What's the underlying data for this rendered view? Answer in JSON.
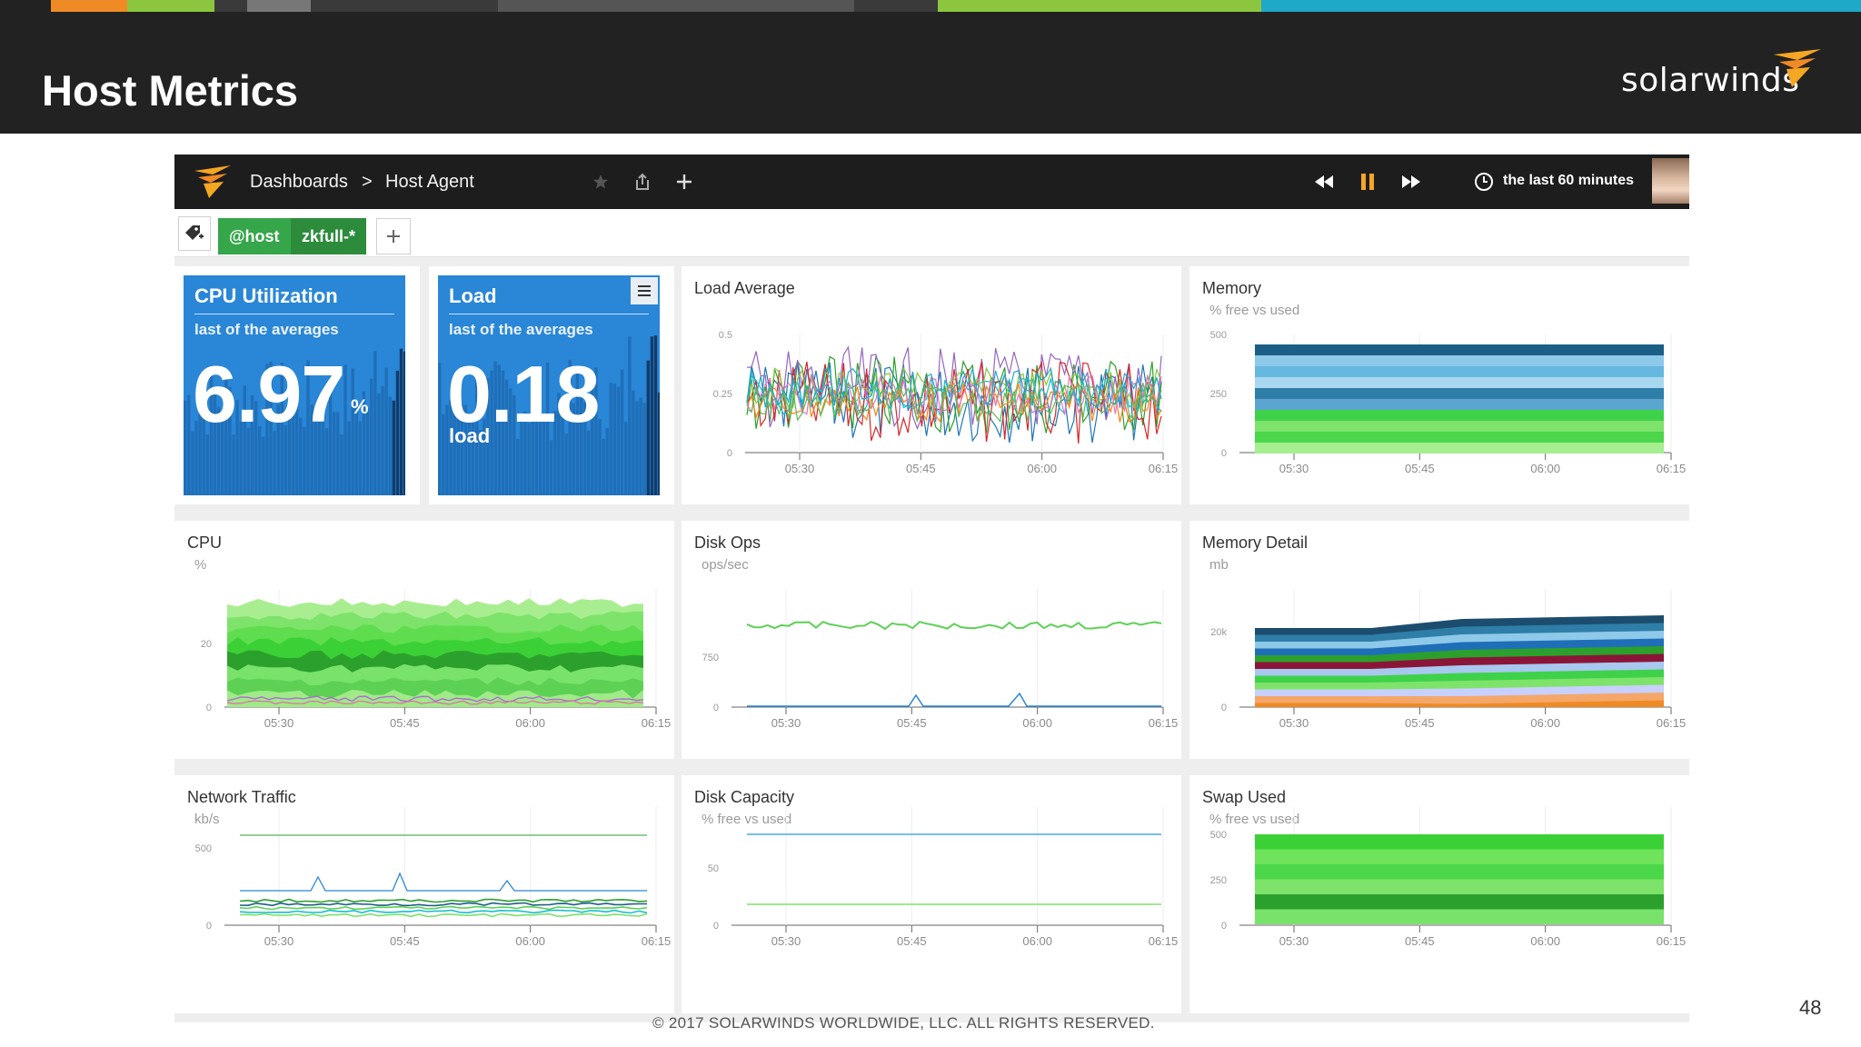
{
  "slide": {
    "title": "Host Metrics",
    "brand": "solarwinds",
    "footer": "© 2017 SOLARWINDS WORLDWIDE, LLC. ALL RIGHTS RESERVED.",
    "page_number": "48",
    "strip_colors": [
      "#222222",
      "#f08a24",
      "#8cc63f",
      "#3a3a3a",
      "#777777",
      "#3a3a3a",
      "#555555",
      "#3a3a3a",
      "#8cc63f",
      "#1fa9c9"
    ]
  },
  "nav": {
    "breadcrumb_root": "Dashboards",
    "breadcrumb_sep": ">",
    "breadcrumb_current": "Host Agent",
    "time_range": "the last 60 minutes",
    "icons": [
      "solarwinds-logo-icon",
      "star-icon",
      "share-icon",
      "plus-icon",
      "rewind-icon",
      "pause-icon",
      "fast-forward-icon",
      "clock-icon"
    ]
  },
  "toolbar": {
    "tag_key": "@host",
    "tag_value": "zkfull-*",
    "add_label": "+"
  },
  "colors": {
    "stat_blue": "#2a86d6",
    "green_dark": "#2ca02c",
    "green_light": "#79e26a",
    "accent_orange": "#f5a623"
  },
  "panels": {
    "cpu_util": {
      "title": "CPU Utilization",
      "subtitle": "last of the averages",
      "value": "6.97",
      "unit": "%"
    },
    "load": {
      "title": "Load",
      "subtitle": "last of the averages",
      "value": "0.18",
      "unit": "load"
    },
    "load_avg": {
      "title": "Load Average",
      "y_ticks": [
        "0.5",
        "0.25",
        "0"
      ],
      "x_ticks": [
        "05:30",
        "05:45",
        "06:00",
        "06:15"
      ]
    },
    "memory": {
      "title": "Memory",
      "subtitle": "% free vs used",
      "y_ticks": [
        "500",
        "250",
        "0"
      ],
      "x_ticks": [
        "05:30",
        "05:45",
        "06:00",
        "06:15"
      ]
    },
    "cpu": {
      "title": "CPU",
      "subtitle": "%",
      "y_ticks": [
        "20",
        "0"
      ],
      "x_ticks": [
        "05:30",
        "05:45",
        "06:00",
        "06:15"
      ]
    },
    "disk_ops": {
      "title": "Disk Ops",
      "subtitle": "ops/sec",
      "y_ticks": [
        "750",
        "0"
      ],
      "x_ticks": [
        "05:30",
        "05:45",
        "06:00",
        "06:15"
      ]
    },
    "memory_detail": {
      "title": "Memory Detail",
      "subtitle": "mb",
      "y_ticks": [
        "20k",
        "0"
      ],
      "x_ticks": [
        "05:30",
        "05:45",
        "06:00",
        "06:15"
      ]
    },
    "network": {
      "title": "Network Traffic",
      "subtitle": "kb/s",
      "y_ticks": [
        "500",
        "0"
      ],
      "x_ticks": [
        "05:30",
        "05:45",
        "06:00",
        "06:15"
      ]
    },
    "disk_capacity": {
      "title": "Disk Capacity",
      "subtitle": "% free vs used",
      "y_ticks": [
        "50",
        "0"
      ],
      "x_ticks": [
        "05:30",
        "05:45",
        "06:00",
        "06:15"
      ]
    },
    "swap": {
      "title": "Swap Used",
      "subtitle": "% free vs used",
      "y_ticks": [
        "500",
        "250",
        "0"
      ],
      "x_ticks": [
        "05:30",
        "05:45",
        "06:00",
        "06:15"
      ]
    }
  }
}
